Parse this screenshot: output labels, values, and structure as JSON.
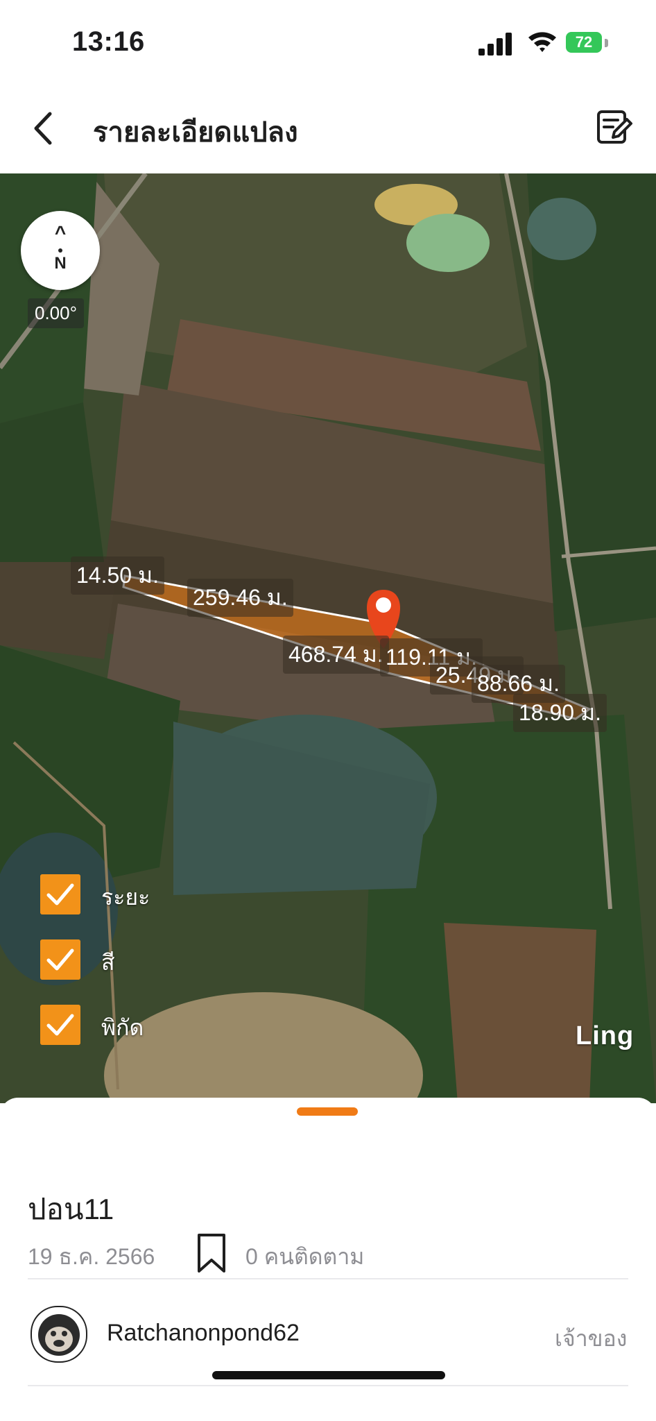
{
  "status_bar": {
    "time": "13:16",
    "battery": "72"
  },
  "header": {
    "title": "รายละเอียดแปลง"
  },
  "map": {
    "compass_label": "N",
    "heading": "0.00°",
    "distances": [
      "14.50 ม.",
      "259.46 ม.",
      "468.74 ม.",
      "119.11 ม.",
      "25.49 ม.",
      "88.66 ม.",
      "18.90 ม."
    ],
    "layers": [
      {
        "label": "ระยะ",
        "checked": true
      },
      {
        "label": "สี",
        "checked": true
      },
      {
        "label": "พิกัด",
        "checked": true
      }
    ],
    "credit": "Ling",
    "plot_color": "#e07a18",
    "marker_color": "#e8461c"
  },
  "sheet": {
    "plot_name": "ปอน11",
    "date": "19 ธ.ค. 2566",
    "followers": "0 คนติดตาม",
    "owner_name": "Ratchanonpond62",
    "owner_role": "เจ้าของ",
    "accent_color": "#f07b16"
  }
}
